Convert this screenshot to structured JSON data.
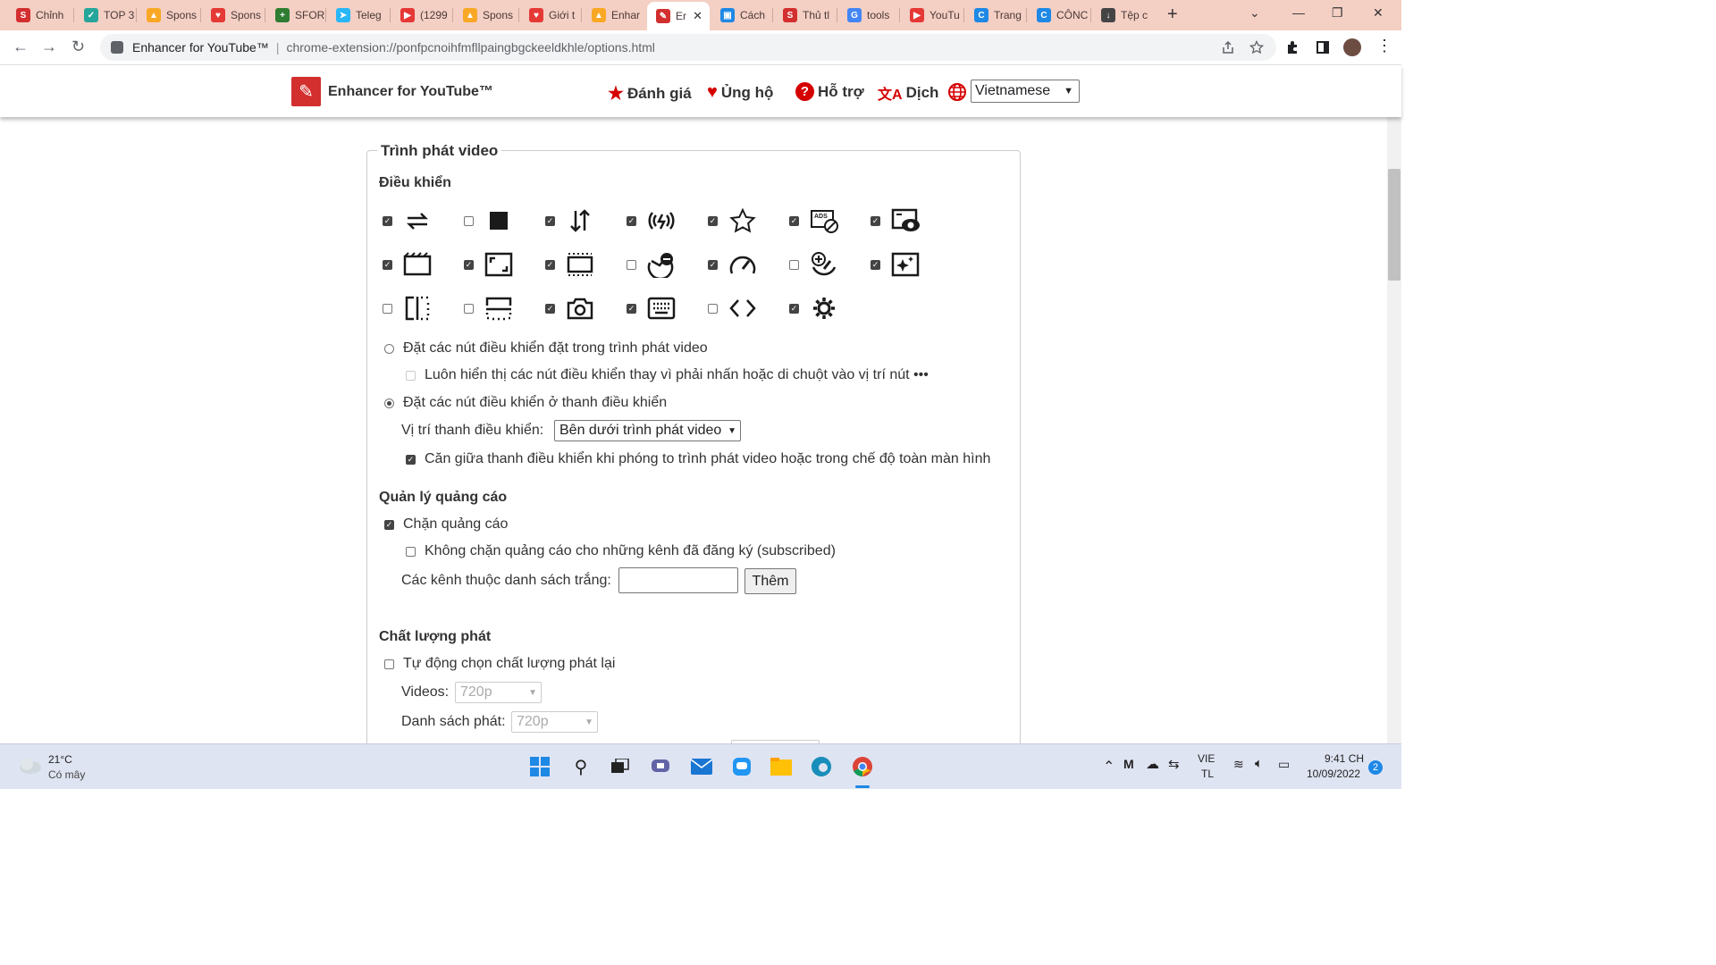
{
  "tabs": [
    {
      "label": "Chỉnh",
      "color": "#d32f2f",
      "glyph": "S"
    },
    {
      "label": "TOP 3",
      "color": "#26a69a",
      "glyph": "✓"
    },
    {
      "label": "Spons",
      "color": "#f9a825",
      "glyph": "▲"
    },
    {
      "label": "Spons",
      "color": "#e53935",
      "glyph": "♥"
    },
    {
      "label": "SFOR",
      "color": "#2e7d32",
      "glyph": "+"
    },
    {
      "label": "Teleg",
      "color": "#29b6f6",
      "glyph": "➤"
    },
    {
      "label": "(1299",
      "color": "#e53935",
      "glyph": "▶"
    },
    {
      "label": "Spons",
      "color": "#f9a825",
      "glyph": "▲"
    },
    {
      "label": "Giới t",
      "color": "#e53935",
      "glyph": "♥"
    },
    {
      "label": "Enhar",
      "color": "#f9a825",
      "glyph": "▲"
    },
    {
      "label": "Er",
      "color": "#d32f2f",
      "glyph": "✎",
      "active": true
    },
    {
      "label": "Cách",
      "color": "#1e88e5",
      "glyph": "▣"
    },
    {
      "label": "Thủ tl",
      "color": "#d32f2f",
      "glyph": "S"
    },
    {
      "label": "tools",
      "color": "#4285f4",
      "glyph": "G"
    },
    {
      "label": "YouTu",
      "color": "#e53935",
      "glyph": "▶"
    },
    {
      "label": "Trang",
      "color": "#1e88e5",
      "glyph": "C"
    },
    {
      "label": "CÔNC",
      "color": "#1e88e5",
      "glyph": "C"
    },
    {
      "label": "Tệp c",
      "color": "#444444",
      "glyph": "↓"
    }
  ],
  "address": {
    "site_name": "Enhancer for YouTube™",
    "url": "chrome-extension://ponfpcnoihfmfllpaingbgckeeldkhle/options.html"
  },
  "header": {
    "brand": "Enhancer for YouTube™",
    "links": [
      {
        "label": "Đánh giá",
        "icon": "star-icon",
        "glyph": "★"
      },
      {
        "label": "Ủng hộ",
        "icon": "heart-icon",
        "glyph": "♥"
      },
      {
        "label": "Hỗ trợ",
        "icon": "help-icon",
        "glyph": "?"
      },
      {
        "label": "Dịch",
        "icon": "translate-icon",
        "glyph": "文A"
      }
    ],
    "language": "Vietnamese"
  },
  "player": {
    "legend": "Trình phát video",
    "controls_heading": "Điều khiển",
    "controls": [
      {
        "name": "loop-icon",
        "checked": true
      },
      {
        "name": "stop-icon",
        "checked": false
      },
      {
        "name": "reverse-playlist-icon",
        "checked": true
      },
      {
        "name": "volume-boost-icon",
        "checked": true
      },
      {
        "name": "whitelist-star-icon",
        "checked": true
      },
      {
        "name": "ads-block-icon",
        "checked": true
      },
      {
        "name": "watch-later-eye-icon",
        "checked": true
      },
      {
        "name": "cinema-mode-icon",
        "checked": true
      },
      {
        "name": "resize-icon",
        "checked": true
      },
      {
        "name": "film-filter-icon",
        "checked": true
      },
      {
        "name": "remove-cinema-icon",
        "checked": false
      },
      {
        "name": "speed-icon",
        "checked": true
      },
      {
        "name": "add-speed-icon",
        "checked": false
      },
      {
        "name": "effects-icon",
        "checked": true
      },
      {
        "name": "flip-horizontal-icon",
        "checked": false
      },
      {
        "name": "flip-vertical-icon",
        "checked": false
      },
      {
        "name": "screenshot-camera-icon",
        "checked": true
      },
      {
        "name": "keyboard-icon",
        "checked": true
      },
      {
        "name": "code-icon",
        "checked": false
      },
      {
        "name": "settings-gear-icon",
        "checked": true
      }
    ],
    "radio_in_player": "Đặt các nút điều khiển đặt trong trình phát video",
    "always_show": "Luôn hiển thị các nút điều khiển thay vì phải nhấn hoặc di chuột vào vị trí nút •••",
    "radio_control_bar": "Đặt các nút điều khiển ở thanh điều khiển",
    "bar_position_label": "Vị trí thanh điều khiển:",
    "bar_position_value": "Bên dưới trình phát video",
    "center_bar": "Căn giữa thanh điều khiển khi phóng to trình phát video hoặc trong chế độ toàn màn hình"
  },
  "ads": {
    "heading": "Quản lý quảng cáo",
    "block_ads": "Chặn quảng cáo",
    "no_block_subscribed": "Không chặn quảng cáo cho những kênh đã đăng ký (subscribed)",
    "whitelist_label": "Các kênh thuộc danh sách trắng:",
    "add_button": "Thêm"
  },
  "quality": {
    "heading": "Chất lượng phát",
    "auto_select": "Tự động chọn chất lượng phát lại",
    "videos_label": "Videos:",
    "videos_value": "720p",
    "playlist_label": "Danh sách phát:",
    "playlist_value": "720p"
  },
  "taskbar": {
    "weather_temp": "21°C",
    "weather_desc": "Có mây",
    "lang_top": "VIE",
    "lang_bottom": "TL",
    "time": "9:41 CH",
    "date": "10/09/2022",
    "notifications": "2"
  }
}
